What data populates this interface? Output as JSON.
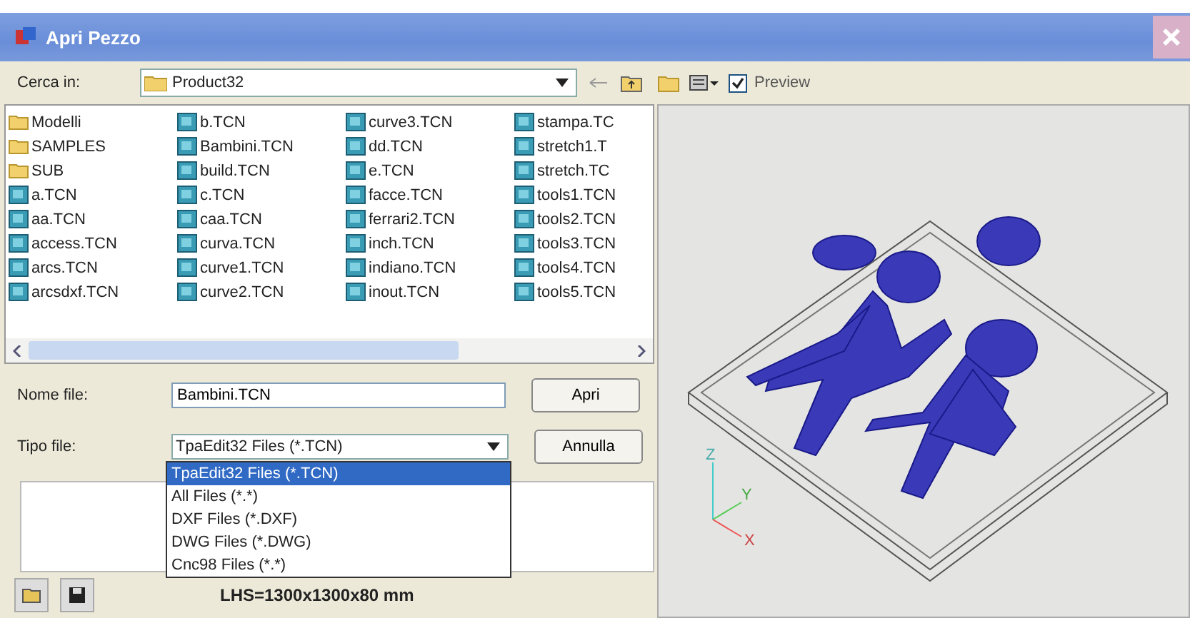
{
  "window": {
    "title": "Apri Pezzo"
  },
  "toolbar": {
    "look_in_label": "Cerca in:",
    "look_in_value": "Product32",
    "preview": {
      "label": "Preview",
      "checked": true
    }
  },
  "files": [
    {
      "name": "Modelli",
      "kind": "folder"
    },
    {
      "name": "SAMPLES",
      "kind": "folder"
    },
    {
      "name": "SUB",
      "kind": "folder"
    },
    {
      "name": "a.TCN",
      "kind": "file"
    },
    {
      "name": "aa.TCN",
      "kind": "file"
    },
    {
      "name": "access.TCN",
      "kind": "file"
    },
    {
      "name": "arcs.TCN",
      "kind": "file"
    },
    {
      "name": "arcsdxf.TCN",
      "kind": "file"
    },
    {
      "name": "b.TCN",
      "kind": "file"
    },
    {
      "name": "Bambini.TCN",
      "kind": "file"
    },
    {
      "name": "build.TCN",
      "kind": "file"
    },
    {
      "name": "c.TCN",
      "kind": "file"
    },
    {
      "name": "caa.TCN",
      "kind": "file"
    },
    {
      "name": "curva.TCN",
      "kind": "file"
    },
    {
      "name": "curve1.TCN",
      "kind": "file"
    },
    {
      "name": "curve2.TCN",
      "kind": "file"
    },
    {
      "name": "curve3.TCN",
      "kind": "file"
    },
    {
      "name": "dd.TCN",
      "kind": "file"
    },
    {
      "name": "e.TCN",
      "kind": "file"
    },
    {
      "name": "facce.TCN",
      "kind": "file"
    },
    {
      "name": "ferrari2.TCN",
      "kind": "file"
    },
    {
      "name": "inch.TCN",
      "kind": "file"
    },
    {
      "name": "indiano.TCN",
      "kind": "file"
    },
    {
      "name": "inout.TCN",
      "kind": "file"
    },
    {
      "name": "stampa.TC",
      "kind": "file"
    },
    {
      "name": "stretch1.T",
      "kind": "file"
    },
    {
      "name": "stretch.TC",
      "kind": "file"
    },
    {
      "name": "tools1.TCN",
      "kind": "file"
    },
    {
      "name": "tools2.TCN",
      "kind": "file"
    },
    {
      "name": "tools3.TCN",
      "kind": "file"
    },
    {
      "name": "tools4.TCN",
      "kind": "file"
    },
    {
      "name": "tools5.TCN",
      "kind": "file"
    }
  ],
  "file_name": {
    "label": "Nome file:",
    "value": "Bambini.TCN"
  },
  "file_type": {
    "label": "Tipo file:",
    "value": "TpaEdit32 Files (*.TCN)",
    "expanded": true,
    "options": [
      {
        "label": "TpaEdit32 Files (*.TCN)",
        "selected": true
      },
      {
        "label": "All Files (*.*)",
        "selected": false
      },
      {
        "label": "DXF Files (*.DXF)",
        "selected": false
      },
      {
        "label": "DWG Files (*.DWG)",
        "selected": false
      },
      {
        "label": "Cnc98 Files (*.*)",
        "selected": false
      }
    ]
  },
  "buttons": [
    "Apri",
    "Annulla"
  ],
  "status": "LHS=1300x1300x80 mm",
  "preview_axes": [
    "Z",
    "Y",
    "X"
  ]
}
